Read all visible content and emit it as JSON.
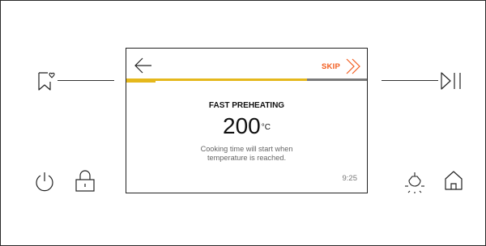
{
  "screen": {
    "skip_label": "SKIP",
    "mode_title": "FAST PREHEATING",
    "temperature": "200",
    "temperature_unit": "°C",
    "message_line1": "Cooking time will start when",
    "message_line2": "temperature is reached.",
    "time": "9:25",
    "progress": 0.75
  },
  "colors": {
    "accent_orange": "#f25c1e",
    "progress_yellow": "#e5b81c",
    "progress_track": "#7a7a7a"
  },
  "icons": {
    "favorites": "bookmark-heart-icon",
    "play_pause": "play-pause-icon",
    "power": "power-icon",
    "lock": "lock-icon",
    "light": "oven-light-icon",
    "home": "home-icon",
    "back": "arrow-left-icon",
    "skip": "double-chevron-right-icon"
  }
}
